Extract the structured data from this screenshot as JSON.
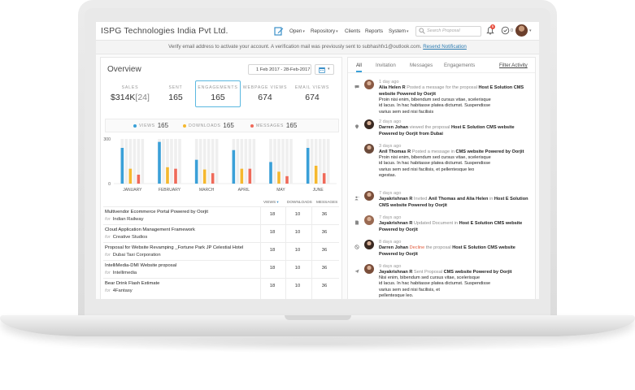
{
  "topbar": {
    "company": "ISPG Technologies India Pvt Ltd.",
    "nav": [
      {
        "label": "Open",
        "caret": true
      },
      {
        "label": "Repository",
        "caret": true
      },
      {
        "label": "Clients",
        "caret": false
      },
      {
        "label": "Reports",
        "caret": false
      },
      {
        "label": "System",
        "caret": true
      }
    ],
    "search_placeholder": "Search Proposal",
    "notification_count": "6",
    "task_count": "0"
  },
  "verify_bar": {
    "message": "Verify email address to activate your account.  A verification mail was previously sent to subhashfx1@outlook.com.",
    "link": "Resend Notification"
  },
  "overview": {
    "title": "Overview",
    "date_range": "1 Feb 2017  -  28-Feb-2017",
    "metrics": [
      {
        "label": "SALES",
        "value": "$314K",
        "sub": "[24]"
      },
      {
        "label": "SENT",
        "value": "165",
        "sub": ""
      },
      {
        "label": "ENGAGEMENTS",
        "value": "165",
        "sub": ""
      },
      {
        "label": "WEBPAGE VIEWS",
        "value": "674",
        "sub": ""
      },
      {
        "label": "EMAIL VIEWS",
        "value": "674",
        "sub": ""
      }
    ],
    "legend": [
      {
        "label": "VIEWS",
        "value": "165",
        "color": "#3aa0d8"
      },
      {
        "label": "DOWNLOADS",
        "value": "165",
        "color": "#f5b82e"
      },
      {
        "label": "MESSAGES",
        "value": "165",
        "color": "#ef6a5a"
      }
    ]
  },
  "chart_data": {
    "type": "bar",
    "categories": [
      "JANUARY",
      "FEBRUARY",
      "MARCH",
      "APRIL",
      "MAY",
      "JUNE"
    ],
    "ylim": [
      0,
      300
    ],
    "yticks": [
      "300",
      "150",
      "0"
    ],
    "series": [
      {
        "name": "VIEWS",
        "color": "#3aa0d8",
        "values": [
          240,
          280,
          160,
          225,
          145,
          240
        ]
      },
      {
        "name": "DOWNLOADS",
        "color": "#f5b82e",
        "values": [
          100,
          110,
          95,
          100,
          80,
          120
        ]
      },
      {
        "name": "MESSAGES",
        "color": "#ef6a5a",
        "values": [
          60,
          100,
          70,
          100,
          50,
          70
        ]
      }
    ],
    "background_bar_max": 300
  },
  "proposals": {
    "headers": {
      "views": "VIEWS",
      "downloads": "DOWNLOADS",
      "messages": "MESSAGES"
    },
    "for_label": "for",
    "rows": [
      {
        "title": "Multivendor Ecommerce Portal Powered by Oorjit",
        "client": "Indian Railway",
        "views": "18",
        "downloads": "10",
        "messages": "36"
      },
      {
        "title": "Cloud Application Management Framework",
        "client": "Creative Studios",
        "views": "18",
        "downloads": "10",
        "messages": "36"
      },
      {
        "title": "Proposal for Website Revamping _Fortune Park JP Celestial Hotel",
        "client": "Dubai Taxi Corporation",
        "views": "18",
        "downloads": "10",
        "messages": "36"
      },
      {
        "title": "IntelliMedia-DMI Website proposal",
        "client": "Intellimedia",
        "views": "18",
        "downloads": "10",
        "messages": "36"
      },
      {
        "title": "Bear Drink Flash Estimate",
        "client": "4Fantasy",
        "views": "18",
        "downloads": "10",
        "messages": "36"
      }
    ]
  },
  "activity": {
    "tabs": [
      "All",
      "Invitation",
      "Messages",
      "Engagements"
    ],
    "filter": "Filter Activity",
    "items": [
      {
        "icon": "message",
        "time": "1 day ago",
        "lines": [
          [
            "b",
            "Alia Helen R"
          ],
          [
            "m",
            " Posted a message for the proposal "
          ],
          [
            "b",
            "Host E Solution CMS"
          ]
        ],
        "line2": "website Powered by Oorjit",
        "body": [
          "Proin nisi enim, bibendum sed cursus vitae, scelerisque",
          "id lacus. In hac habitasse platea dictumst. Suspendisse",
          "varius sem sed nisi facilisis"
        ]
      },
      {
        "icon": "location",
        "time": "2 days ago",
        "lines": [
          [
            "b",
            "Darren Johan"
          ],
          [
            "m",
            " viewed the proposal  "
          ],
          [
            "b",
            "Host E Solution CMS website"
          ]
        ],
        "line2": "Powered by Oorjit from Dubai",
        "body": []
      },
      {
        "icon": "none",
        "time": "3 days ago",
        "lines": [
          [
            "b",
            "Anil Thomas R"
          ],
          [
            "m",
            " Posted a message in "
          ],
          [
            "b",
            "CMS website Powered by Oorjit"
          ]
        ],
        "line2": "",
        "body": [
          "Proin nisi enim, bibendum sed cursus vitae, scelerisque",
          "id lacus. In hac habitasse platea dictumst. Suspendisse",
          "varius sem sed nisi facilisis, et pellentesque leo",
          "egestas."
        ]
      },
      {
        "icon": "user",
        "time": "7 days ago",
        "lines": [
          [
            "b",
            "Jayakrishnan R"
          ],
          [
            "m",
            " Invited "
          ],
          [
            "b",
            "Anil Thomas and Alia Helen"
          ],
          [
            "m",
            " in "
          ],
          [
            "b",
            "Host E Solution"
          ]
        ],
        "line2": "CMS website Powered by Oorjit",
        "body": []
      },
      {
        "icon": "doc",
        "time": "7 days ago",
        "lines": [
          [
            "b",
            "Jayakrishnan R"
          ],
          [
            "m",
            " Updated Document in "
          ],
          [
            "b",
            "Host E Solution CMS website"
          ]
        ],
        "line2": "Powered by Oorjit",
        "body": []
      },
      {
        "icon": "decline",
        "time": "8 days ago",
        "lines": [
          [
            "b",
            "Darren Johan"
          ],
          [
            "r",
            " Decline"
          ],
          [
            "m",
            " the proposal "
          ],
          [
            "b",
            "Host E Solution CMS website"
          ]
        ],
        "line2": "Powered by Oorjit",
        "body": []
      },
      {
        "icon": "send",
        "time": "9 days ago",
        "lines": [
          [
            "b",
            "Jayakrishnan R"
          ],
          [
            "m",
            " Sent Proposal "
          ],
          [
            "b",
            "CMS website Powered by Oorjit"
          ]
        ],
        "line2": "",
        "body": [
          "Nisi enim, bibendum sed cursus vitae, scelerisque",
          "id lacus. In hac habitasse platea dictumst. Suspendisse",
          "varius sem sed nisi facilisis, et",
          "pellentesque leo."
        ]
      }
    ]
  }
}
